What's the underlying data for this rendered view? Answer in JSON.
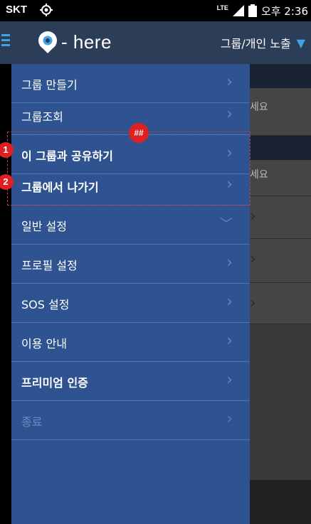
{
  "status_bar": {
    "carrier": "SKT",
    "network": "LTE",
    "time": "오후 2:36"
  },
  "header": {
    "logo_text": "here",
    "group_toggle_label": "그룹/개인 노출"
  },
  "background": {
    "row_snippets": [
      "세요",
      "세요"
    ]
  },
  "menu": {
    "items": [
      {
        "label": "그룹 만들기"
      },
      {
        "label": "그룹조회"
      },
      {
        "label": "이 그룹과 공유하기"
      },
      {
        "label": "그룹에서 나가기"
      },
      {
        "label": "일반 설정"
      },
      {
        "label": "프로필 설정"
      },
      {
        "label": "SOS 설정"
      },
      {
        "label": "이용 안내"
      },
      {
        "label": "프리미엄 인증"
      },
      {
        "label": "종료"
      }
    ]
  },
  "annotations": {
    "tag": "##",
    "marker_1": "1",
    "marker_2": "2"
  },
  "colors": {
    "drawer_bg": "#2e5390",
    "header_bg": "#2c3e57",
    "accent": "#3fa5e0",
    "annotation": "#e02020"
  }
}
